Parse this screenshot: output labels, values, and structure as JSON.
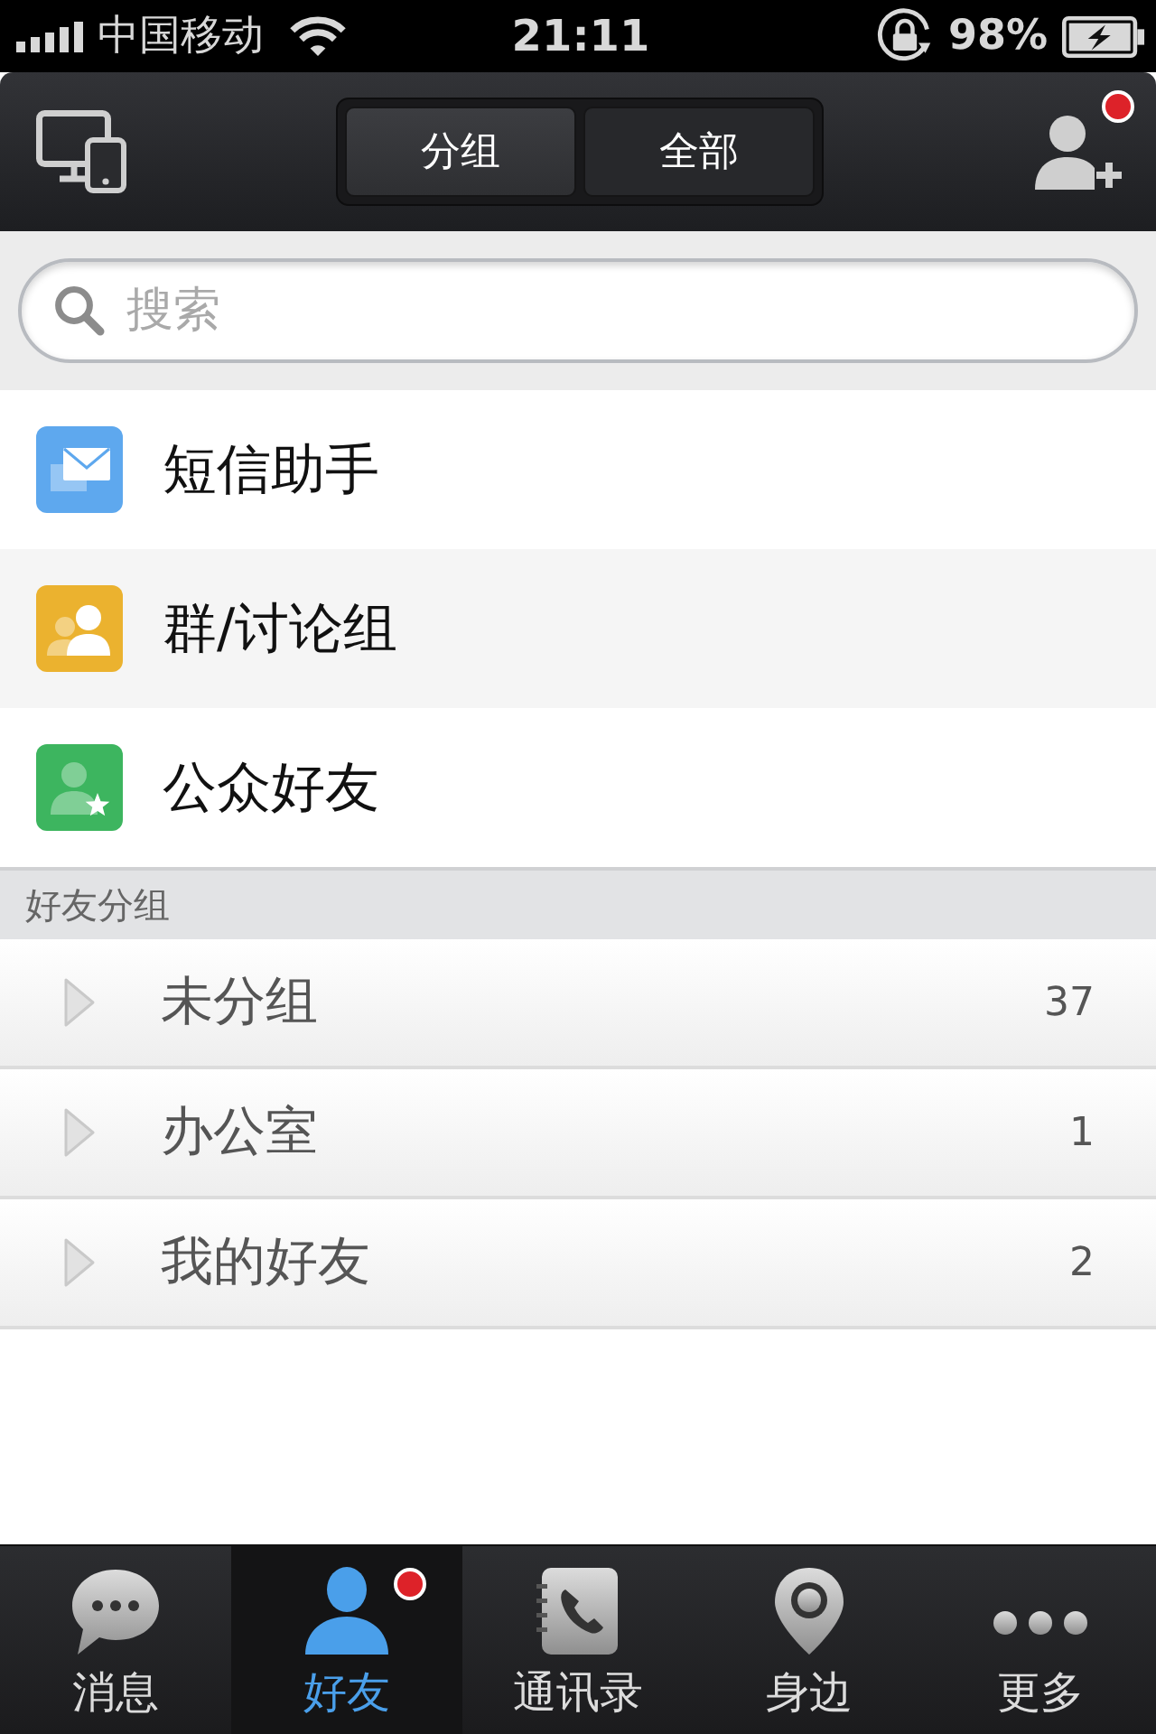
{
  "status_bar": {
    "carrier": "中国移动",
    "time": "21:11",
    "battery": "98%"
  },
  "header": {
    "segments": [
      {
        "label": "分组",
        "selected": true
      },
      {
        "label": "全部",
        "selected": false
      }
    ],
    "add_friend_badge": true
  },
  "search": {
    "placeholder": "搜索"
  },
  "shortcuts": [
    {
      "label": "短信助手",
      "kind": "sms",
      "color": "#5ea8ee"
    },
    {
      "label": "群/讨论组",
      "kind": "group",
      "color": "#ebb22f"
    },
    {
      "label": "公众好友",
      "kind": "public",
      "color": "#3db55f"
    }
  ],
  "friend_groups": {
    "title": "好友分组",
    "groups": [
      {
        "name": "未分组",
        "count": "37",
        "expanded": false
      },
      {
        "name": "办公室",
        "count": "1",
        "expanded": false
      },
      {
        "name": "我的好友",
        "count": "2",
        "expanded": false
      }
    ]
  },
  "tab_bar": [
    {
      "label": "消息",
      "kind": "messages",
      "selected": false,
      "badge": false
    },
    {
      "label": "好友",
      "kind": "friends",
      "selected": true,
      "badge": true
    },
    {
      "label": "通讯录",
      "kind": "contacts",
      "selected": false,
      "badge": false
    },
    {
      "label": "身边",
      "kind": "nearby",
      "selected": false,
      "badge": false
    },
    {
      "label": "更多",
      "kind": "more",
      "selected": false,
      "badge": false
    }
  ]
}
